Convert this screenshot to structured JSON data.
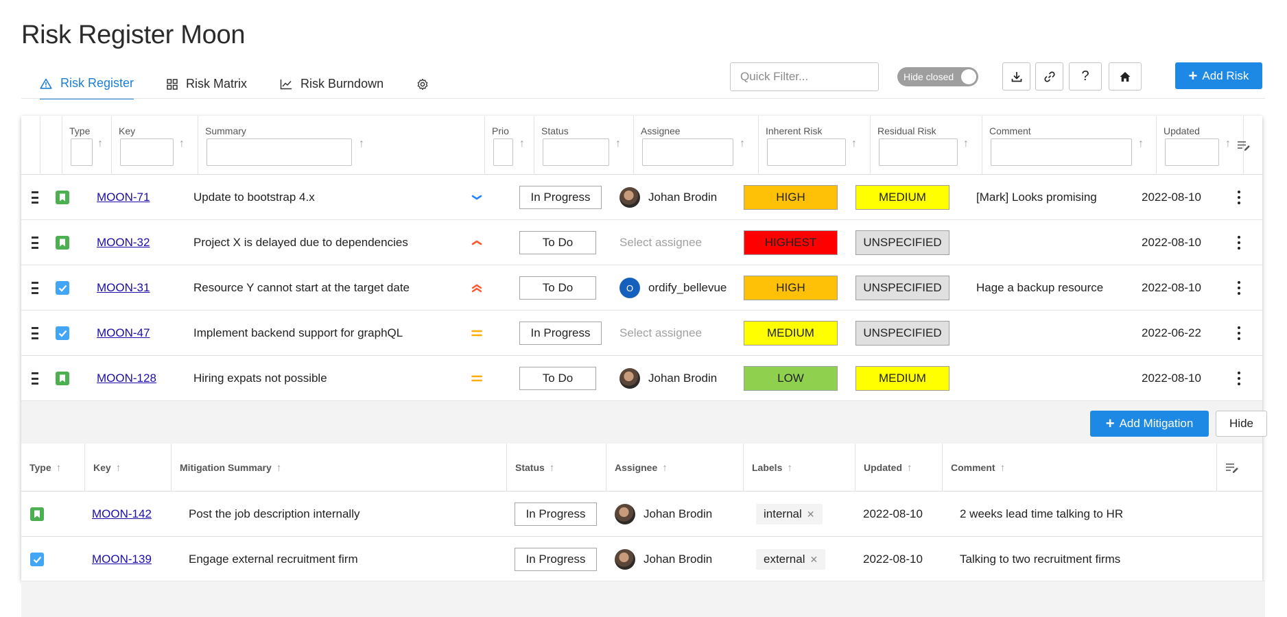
{
  "page": {
    "title": "Risk Register Moon"
  },
  "tabs": [
    {
      "label": "Risk Register",
      "icon": "warning-triangle-icon",
      "active": true
    },
    {
      "label": "Risk Matrix",
      "icon": "grid-icon",
      "active": false
    },
    {
      "label": "Risk Burndown",
      "icon": "line-chart-icon",
      "active": false
    },
    {
      "label": "",
      "icon": "gear-icon",
      "active": false
    }
  ],
  "toolbar": {
    "quick_filter_placeholder": "Quick Filter...",
    "hide_closed_label": "Hide closed",
    "add_risk_label": "Add Risk"
  },
  "risk_table": {
    "headers": {
      "type": "Type",
      "key": "Key",
      "summary": "Summary",
      "prio": "Prio",
      "status": "Status",
      "assignee": "Assignee",
      "inherent": "Inherent Risk",
      "residual": "Residual Risk",
      "comment": "Comment",
      "updated": "Updated"
    },
    "rows": [
      {
        "type": "story",
        "key": "MOON-71",
        "summary": "Update to bootstrap 4.x",
        "prio": "low",
        "status": "In Progress",
        "assignee": "Johan Brodin",
        "avatar": "photo",
        "inherent": "HIGH",
        "residual": "MEDIUM",
        "comment": "[Mark] Looks promising",
        "updated": "2022-08-10"
      },
      {
        "type": "story",
        "key": "MOON-32",
        "summary": "Project X is delayed due to dependencies",
        "prio": "high",
        "status": "To Do",
        "assignee": "Select assignee",
        "avatar": "none",
        "inherent": "HIGHEST",
        "residual": "UNSPECIFIED",
        "comment": "",
        "updated": "2022-08-10"
      },
      {
        "type": "task",
        "key": "MOON-31",
        "summary": "Resource Y cannot start at the target date",
        "prio": "highest",
        "status": "To Do",
        "assignee": "ordify_bellevue",
        "avatar": "letter",
        "avatar_letter": "O",
        "inherent": "HIGH",
        "residual": "UNSPECIFIED",
        "comment": "Hage a backup resource",
        "updated": "2022-08-10"
      },
      {
        "type": "task",
        "key": "MOON-47",
        "summary": "Implement backend support for graphQL",
        "prio": "medium",
        "status": "In Progress",
        "assignee": "Select assignee",
        "avatar": "none",
        "inherent": "MEDIUM",
        "residual": "UNSPECIFIED",
        "comment": "",
        "updated": "2022-06-22"
      },
      {
        "type": "story",
        "key": "MOON-128",
        "summary": "Hiring expats not possible",
        "prio": "medium",
        "status": "To Do",
        "assignee": "Johan Brodin",
        "avatar": "photo",
        "inherent": "LOW",
        "residual": "MEDIUM",
        "comment": "",
        "updated": "2022-08-10"
      }
    ]
  },
  "risk_colors": {
    "HIGHEST": "#ff0000",
    "HIGH": "#ffc107",
    "MEDIUM": "#ffff00",
    "LOW": "#8fd14f",
    "UNSPECIFIED": "#e0e0e0"
  },
  "prio_colors": {
    "low": "#2684ff",
    "high": "#ff5630",
    "highest": "#ff5630",
    "medium": "#ffab00"
  },
  "mitigation": {
    "add_label": "Add Mitigation",
    "hide_label": "Hide",
    "headers": {
      "type": "Type",
      "key": "Key",
      "summary": "Mitigation Summary",
      "status": "Status",
      "assignee": "Assignee",
      "labels": "Labels",
      "updated": "Updated",
      "comment": "Comment"
    },
    "rows": [
      {
        "type": "story",
        "key": "MOON-142",
        "summary": "Post the job description internally",
        "status": "In Progress",
        "assignee": "Johan Brodin",
        "label": "internal",
        "updated": "2022-08-10",
        "comment": "2 weeks lead time talking to HR"
      },
      {
        "type": "task",
        "key": "MOON-139",
        "summary": "Engage external recruitment firm",
        "status": "In Progress",
        "assignee": "Johan Brodin",
        "label": "external",
        "updated": "2022-08-10",
        "comment": "Talking to two recruitment firms"
      }
    ]
  }
}
